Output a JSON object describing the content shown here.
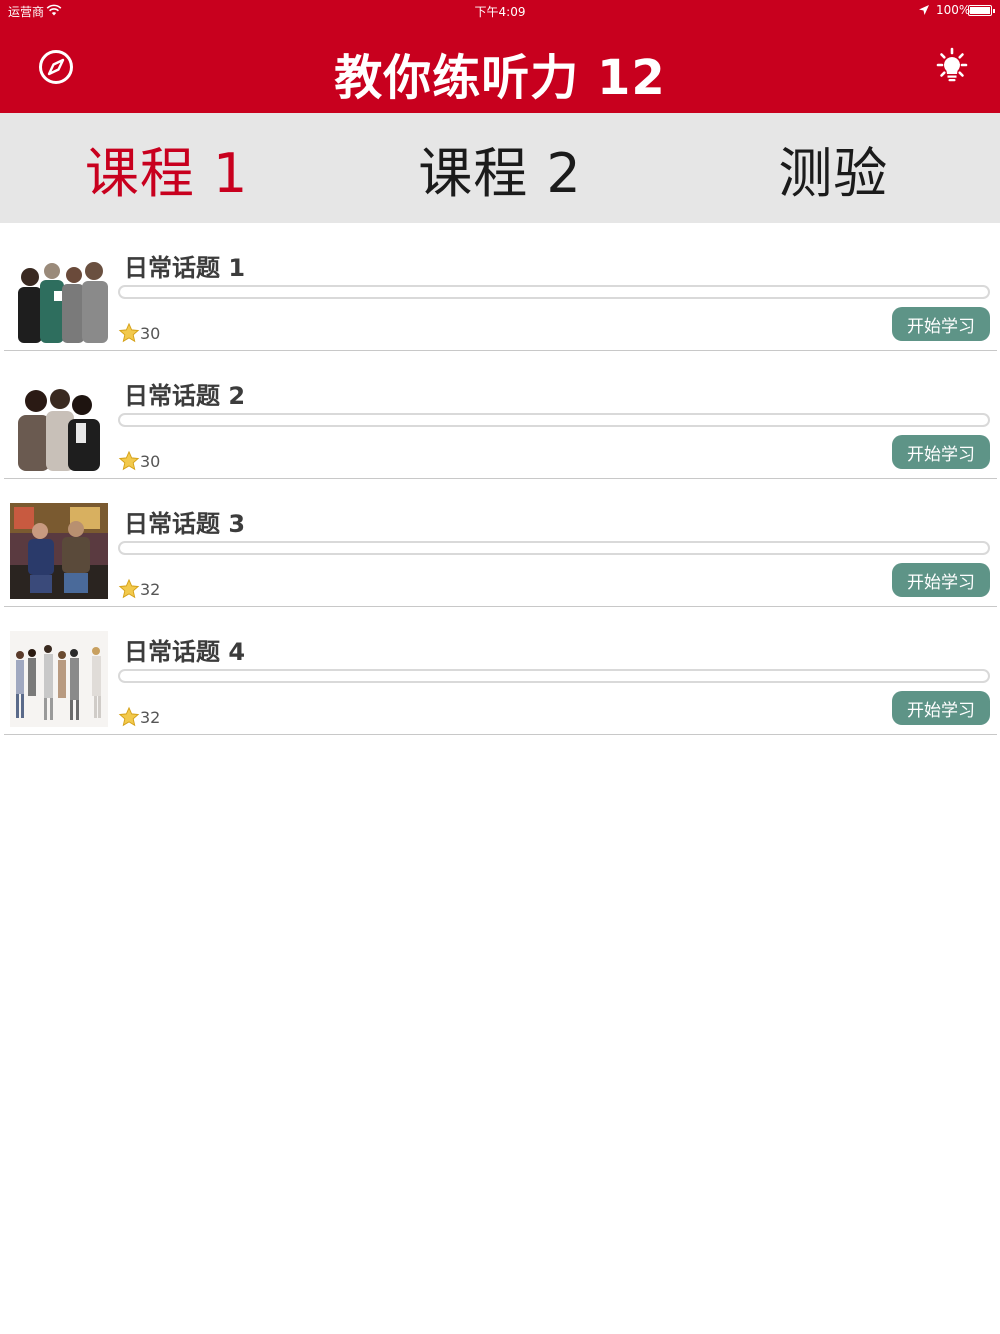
{
  "status_bar": {
    "carrier": "运营商",
    "time": "下午4:09",
    "battery": "100%"
  },
  "nav": {
    "title": "教你练听力 12",
    "left_icon": "compass-icon",
    "right_icon": "lightbulb-icon"
  },
  "tabs": [
    {
      "label": "课程 1",
      "active": true
    },
    {
      "label": "课程 2",
      "active": false
    },
    {
      "label": "测验",
      "active": false
    }
  ],
  "lessons": [
    {
      "title": "日常话题 1",
      "stars": "30",
      "progress": 0,
      "button": "开始学习",
      "image": "group-conversation-photo"
    },
    {
      "title": "日常话题 2",
      "stars": "30",
      "progress": 0,
      "button": "开始学习",
      "image": "people-chatting-photo"
    },
    {
      "title": "日常话题 3",
      "stars": "32",
      "progress": 0,
      "button": "开始学习",
      "image": "street-conversation-photo"
    },
    {
      "title": "日常话题 4",
      "stars": "32",
      "progress": 0,
      "button": "开始学习",
      "image": "party-group-photo"
    }
  ],
  "colors": {
    "brand_red": "#c8001e",
    "accent_green": "#5e9487",
    "tab_bg": "#e6e6e6"
  }
}
